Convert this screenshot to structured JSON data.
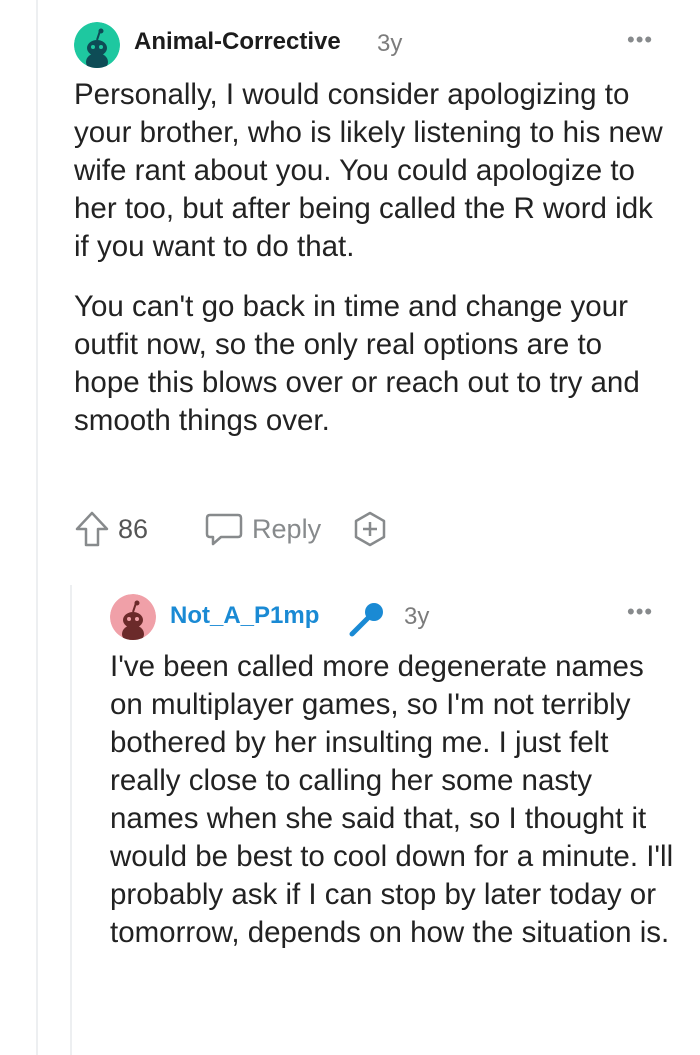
{
  "comments": [
    {
      "username": "Animal-Corrective",
      "age": "3y",
      "paragraphs": [
        "Personally, I would consider apologizing to your brother, who is likely listening to his new wife rant about you. You could apologize to her too, but after being called the R word idk if you want to do that.",
        "You can't go back in time and change your outfit now, so the only real options are to hope this blows over or reach out to try and smooth things over."
      ],
      "votes": "86",
      "reply_label": "Reply",
      "avatar_color": "#1ec8a0"
    },
    {
      "username": "Not_A_P1mp",
      "age": "3y",
      "paragraphs": [
        "I've been called more degenerate names on multiplayer games, so I'm not terribly bothered by her insulting me. I just felt really close to calling her some nasty names when she said that, so I thought it would be best to cool down for a minute. I'll probably ask if I can stop by later today or tomorrow, depends on how the situation is."
      ],
      "username_color": "#1a8ad4",
      "avatar_color": "#f0a0a8"
    }
  ],
  "more_glyph": "•••"
}
